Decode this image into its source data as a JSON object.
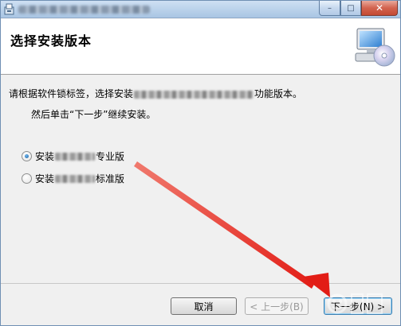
{
  "window": {
    "icons": {
      "app": "installer-icon",
      "minimize": "minimize-icon",
      "maximize": "maximize-icon",
      "close": "close-icon"
    },
    "controls": {
      "minimize": "–",
      "maximize": "□",
      "close": "✕"
    }
  },
  "header": {
    "title": "选择安装版本",
    "icon": "computer-cd-icon"
  },
  "body": {
    "desc_prefix": "请根据软件锁标签，选择安装",
    "desc_suffix": "功能版本。",
    "instruction": "然后单击“下一步”继续安装。",
    "options": [
      {
        "prefix": "安装",
        "suffix": "专业版",
        "checked": true
      },
      {
        "prefix": "安装",
        "suffix": "标准版",
        "checked": false
      }
    ]
  },
  "footer": {
    "cancel_label": "取消",
    "back_label": "< 上一步(B)",
    "next_label": "下一步(N) >"
  },
  "annotation": {
    "arrow_color": "#e8302a"
  },
  "colors": {
    "accent": "#3c7fb1",
    "title_bar": "#b9d1ea"
  }
}
